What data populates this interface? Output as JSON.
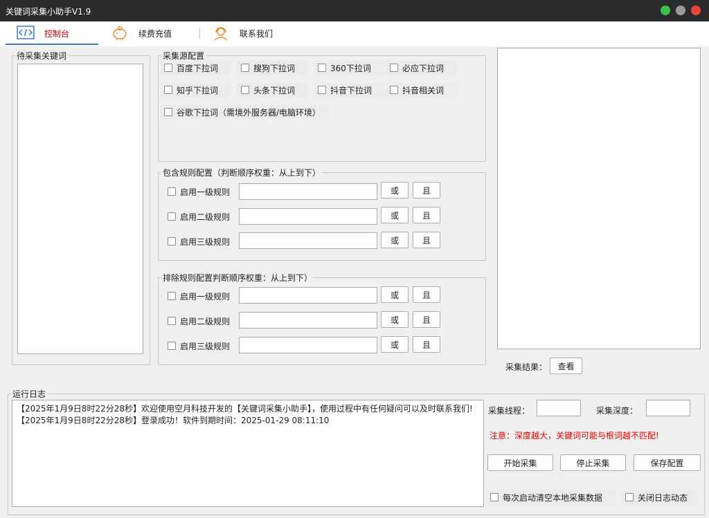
{
  "window": {
    "title": "关键词采集小助手V1.9"
  },
  "menu": {
    "items": [
      {
        "label": "控制台",
        "icon": "code-icon"
      },
      {
        "label": "续费充值",
        "icon": "piggy-bank-icon"
      },
      {
        "label": "联系我们",
        "icon": "support-agent-icon"
      }
    ]
  },
  "keywords_panel": {
    "title": "待采集关键词"
  },
  "source_config": {
    "title": "采集源配置",
    "options": [
      "百度下拉词",
      "搜狗下拉词",
      "360下拉词",
      "必应下拉词",
      "知乎下拉词",
      "头条下拉词",
      "抖音下拉词",
      "抖音相关词",
      "谷歌下拉词（需境外服务器/电脑环境）"
    ]
  },
  "include_rules": {
    "title": "包含规则配置（判断顺序权重：从上到下）",
    "rules": [
      "启用一级规则",
      "启用二级规则",
      "启用三级规则"
    ],
    "or_label": "或",
    "and_label": "且"
  },
  "exclude_rules": {
    "title": "排除规则配置判断顺序权重：从上到下）",
    "rules": [
      "启用一级规则",
      "启用二级规则",
      "启用三级规则"
    ],
    "or_label": "或",
    "and_label": "且"
  },
  "results": {
    "label": "采集结果：",
    "view_button": "查看"
  },
  "log": {
    "title": "运行日志",
    "lines": [
      "【2025年1月9日8时22分28秒】欢迎使用空月科技开发的【关键词采集小助手】，使用过程中有任何疑问可以及时联系我们!",
      "【2025年1月9日8时22分28秒】登录成功！软件到期时间：2025-01-29 08:11:10"
    ]
  },
  "controls": {
    "threads_label": "采集线程：",
    "depth_label": "采集深度：",
    "warning": "注意：深度越大，关键词可能与根词越不匹配!",
    "start_button": "开始采集",
    "stop_button": "停止采集",
    "save_button": "保存配置",
    "clear_on_start": "每次启动清空本地采集数据",
    "close_log": "关闭日志动态"
  },
  "colors": {
    "accent": "#3a78c8",
    "warning": "#e00000",
    "active_tab": "#c00000"
  }
}
